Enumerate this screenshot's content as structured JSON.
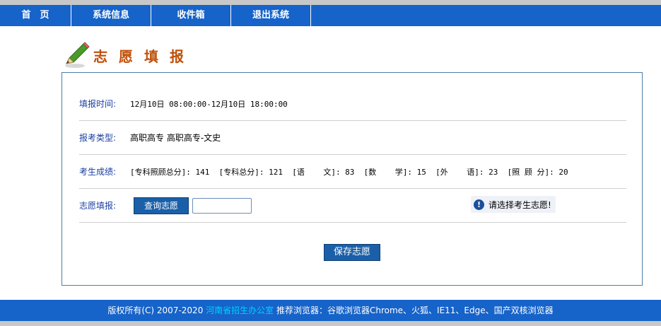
{
  "nav": {
    "items": [
      {
        "label": "首　页"
      },
      {
        "label": "系统信息"
      },
      {
        "label": "收件箱"
      },
      {
        "label": "退出系统"
      }
    ]
  },
  "page": {
    "title": "志愿填报"
  },
  "form": {
    "time_label": "填报时间:",
    "time_value": "12月10日 08:00:00-12月10日 18:00:00",
    "type_label": "报考类型:",
    "type_value": "高职高专 高职高专-文史",
    "score_label": "考生成绩:",
    "score_value": "[专科照顾总分]: 141  [专科总分]: 121  [语    文]: 83  [数    学]: 15  [外    语]: 23  [照 顾 分]: 20",
    "wish_label": "志愿填报:",
    "query_button": "查询志愿",
    "wish_input_value": "",
    "tip_icon": "!",
    "tip_text": "请选择考生志愿!",
    "save_button": "保存志愿"
  },
  "footer": {
    "copyright": "版权所有(C) 2007-2020 ",
    "org": "河南省招生办公室",
    "browsers": "  推荐浏览器：谷歌浏览器Chrome、火狐、IE11、Edge、国产双核浏览器"
  },
  "colors": {
    "nav_bg": "#1663c9",
    "title": "#c0500a",
    "label": "#1a3fa0",
    "button": "#1a5fa8"
  },
  "icons": {
    "title_icon": "pencil-icon",
    "tip_icon": "info-icon"
  }
}
